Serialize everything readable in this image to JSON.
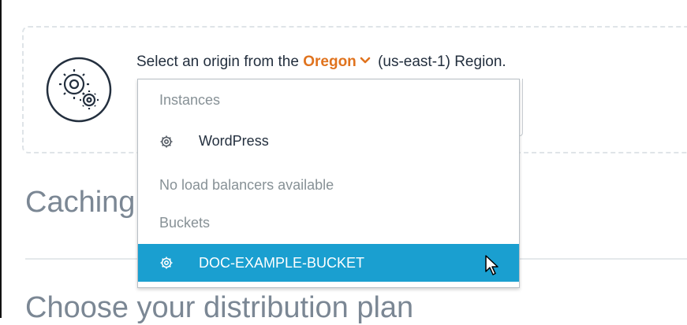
{
  "origin": {
    "prompt_prefix": "Select an origin from the",
    "region_name": "Oregon",
    "prompt_suffix": "(us-east-1) Region."
  },
  "dropdown": {
    "instances_header": "Instances",
    "instance_item": "WordPress",
    "load_balancers_header": "No load balancers available",
    "buckets_header": "Buckets",
    "bucket_item": "DOC-EXAMPLE-BUCKET"
  },
  "sections": {
    "caching_title": "Caching",
    "plan_title": "Choose your distribution plan"
  },
  "colors": {
    "accent_orange": "#e0731e",
    "selected_blue": "#1a9fd0"
  },
  "icons": {
    "origin": "gears-icon",
    "item": "gear-icon",
    "region_toggle": "chevron-down-icon"
  }
}
